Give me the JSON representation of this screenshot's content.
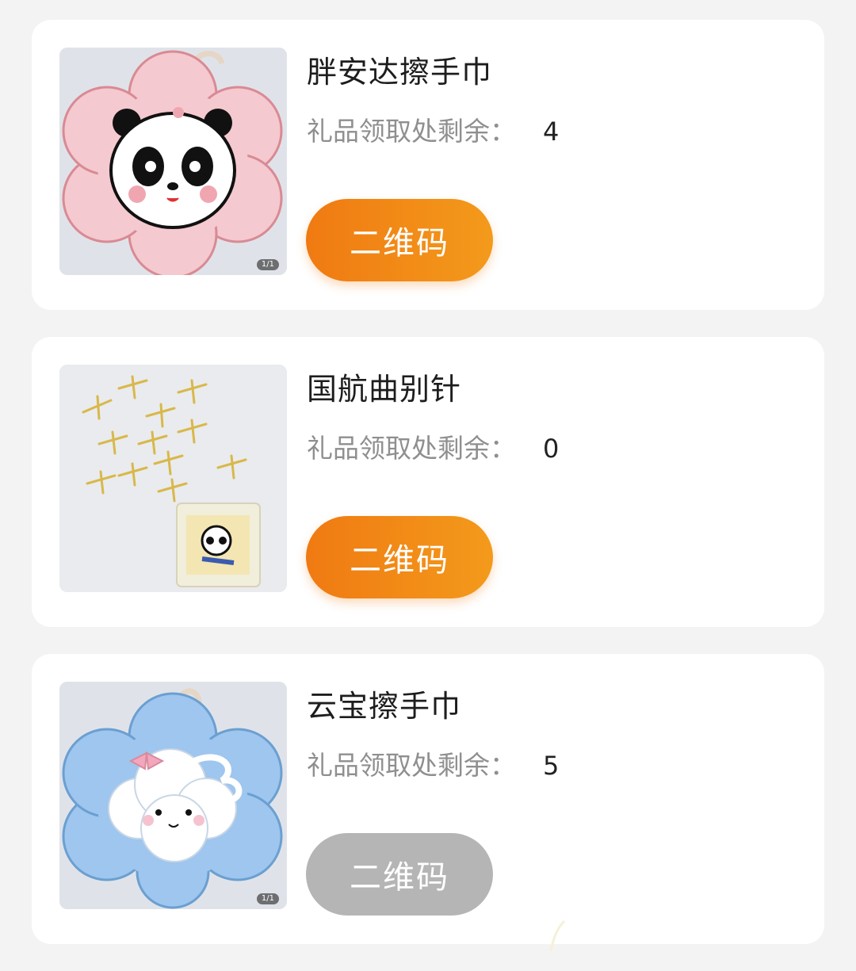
{
  "gift_list": {
    "stock_label": "礼品领取处剩余：",
    "items": [
      {
        "name": "胖安达擦手巾",
        "stock": "4",
        "button_label": "二维码",
        "button_enabled": true,
        "image_icon": "panda-flower-towel-image",
        "image_badge": "1/1"
      },
      {
        "name": "国航曲别针",
        "stock": "0",
        "button_label": "二维码",
        "button_enabled": true,
        "image_icon": "airplane-paperclips-image"
      },
      {
        "name": "云宝擦手巾",
        "stock": "5",
        "button_label": "二维码",
        "button_enabled": false,
        "image_icon": "cloud-flower-towel-image",
        "image_badge": "1/1"
      }
    ]
  },
  "colors": {
    "button_active_start": "#f07a12",
    "button_active_end": "#f39a1b",
    "button_disabled": "#b5b5b5",
    "label_gray": "#8f8f8f",
    "page_bg": "#f3f3f3"
  }
}
